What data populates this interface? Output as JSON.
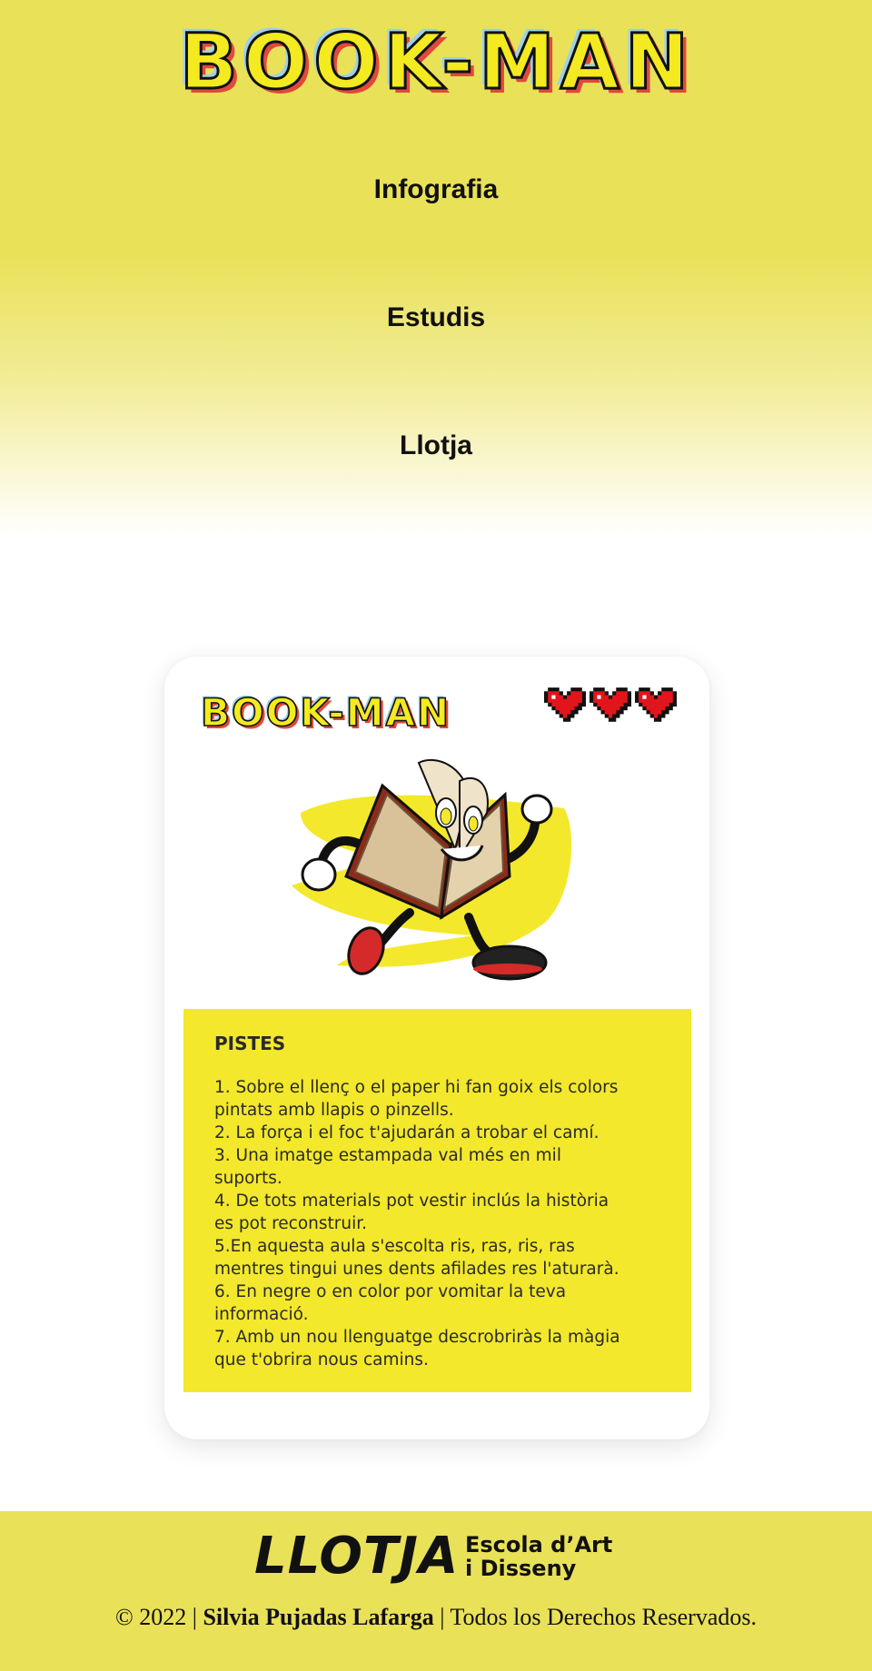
{
  "header": {
    "logo_text": "BOOK-MAN"
  },
  "nav": {
    "items": [
      {
        "label": "Infografia"
      },
      {
        "label": "Estudis"
      },
      {
        "label": "Llotja"
      }
    ]
  },
  "card": {
    "logo_text": "BOOK-MAN",
    "hearts_count": 3,
    "pistes": {
      "title": "PISTES",
      "items": [
        "1. Sobre el llenç o el paper hi fan goix els colors",
        "pintats amb llapis o pinzells.",
        "2. La força i el foc t'ajudarán a trobar el camí.",
        "3. Una imatge estampada val més en mil",
        "suports.",
        "4. De tots materials pot vestir inclús la història",
        "es pot reconstruir.",
        "5.En aquesta aula s'escolta ris, ras, ris, ras",
        "mentres tingui unes dents afilades res l'aturarà.",
        "6. En negre o en color por vomitar la teva",
        "informació.",
        "7. Amb un nou llenguatge descrobriràs la màgia",
        "que t'obrira nous camins."
      ]
    }
  },
  "footer": {
    "logo_word": "LLOTJA",
    "logo_line1": "Escola d’Art",
    "logo_line2": "i Disseny",
    "copyright_prefix": "© 2022 |",
    "copyright_name": "Silvia Pujadas Lafarga",
    "copyright_suffix": "| Todos los Derechos Reservados."
  },
  "colors": {
    "brand_yellow": "#e9e158",
    "card_yellow": "#f3e82b",
    "heart_red": "#e3151c"
  }
}
